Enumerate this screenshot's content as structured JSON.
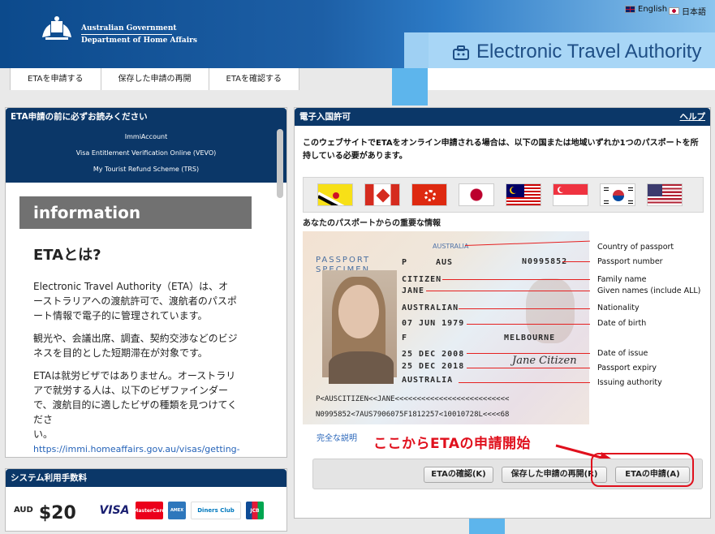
{
  "header": {
    "gov_line1": "Australian Government",
    "gov_line2": "Department of Home Affairs",
    "lang_english": "English",
    "lang_japanese": "日本語",
    "title": "Electronic Travel Authority"
  },
  "nav": {
    "items": [
      "ETAを申請する",
      "保存した申請の再開",
      "ETAを確認する"
    ]
  },
  "left_panel": {
    "title": "ETA申請の前に必ずお読みください",
    "links": [
      "ImmiAccount",
      "Visa Entitlement Verification Online (VEVO)",
      "My Tourist Refund Scheme (TRS)"
    ],
    "info_heading": "information",
    "eta_heading": "ETAとは?",
    "p1": "Electronic Travel Authority（ETA）は、オーストラリアへの渡航許可で、渡航者のパスポート情報で電子的に管理されています。",
    "p2": "観光や、会議出席、調査、契約交渉などのビジネスを目的とした短期滞在が対象です。",
    "p3": "ETAは就労ビザではありません。オーストラリアで就労する人は、以下のビザファインダーで、渡航目的に適したビザの種類を見つけてくださ",
    "p3_tail": "い。",
    "link_url": "https://immi.homeaffairs.gov.au/visas/getting-a-visa/visa-finder"
  },
  "fee": {
    "title": "システム利用手数料",
    "currency": "AUD",
    "amount": "$20",
    "cards": [
      "VISA",
      "MasterCard",
      "AMEX",
      "Diners Club",
      "JCB"
    ]
  },
  "right_panel": {
    "title": "電子入国許可",
    "help": "ヘルプ",
    "intro": "このウェブサイトでETAをオンライン申請される場合は、以下の国または地域いずれか1つのパスポートを所持している必要があります。",
    "flags": [
      "brunei",
      "canada",
      "hong-kong",
      "japan",
      "malaysia",
      "singapore",
      "south-korea",
      "usa"
    ],
    "passport_caption": "あなたのパスポートからの重要な情報",
    "passport": {
      "specimen": "PASSPORT SPECIMEN",
      "type": "P",
      "code": "AUS",
      "country": "AUSTRALIA",
      "doc_no": "N0995852",
      "surname": "CITIZEN",
      "given": "JANE",
      "nationality": "AUSTRALIAN",
      "dob": "07 JUN 1979",
      "sex": "F",
      "place": "MELBOURNE",
      "issue": "25 DEC 2008",
      "expiry": "25 DEC 2018",
      "authority": "AUSTRALIA",
      "signature": "Jane Citizen",
      "mrz1": "P<AUSCITIZEN<<JANE<<<<<<<<<<<<<<<<<<<<<<<<<<",
      "mrz2": "N0995852<7AUS7906075F1812257<10010728L<<<<68"
    },
    "labels": [
      "Country of passport",
      "Passport number",
      "Family name",
      "Given names (include ALL)",
      "Nationality",
      "Date of birth",
      "Date of issue",
      "Passport expiry",
      "Issuing authority"
    ],
    "full_explain": "完全な説明",
    "callout": "ここからETAの申請開始",
    "buttons": {
      "check": "ETAの確認(K)",
      "resume": "保存した申請の再開(R)",
      "apply": "ETAの申請(A)"
    }
  },
  "colors": {
    "navy": "#0b3768",
    "band": "#5db5ec",
    "callout_red": "#e0101d",
    "link_blue": "#2563b8"
  }
}
